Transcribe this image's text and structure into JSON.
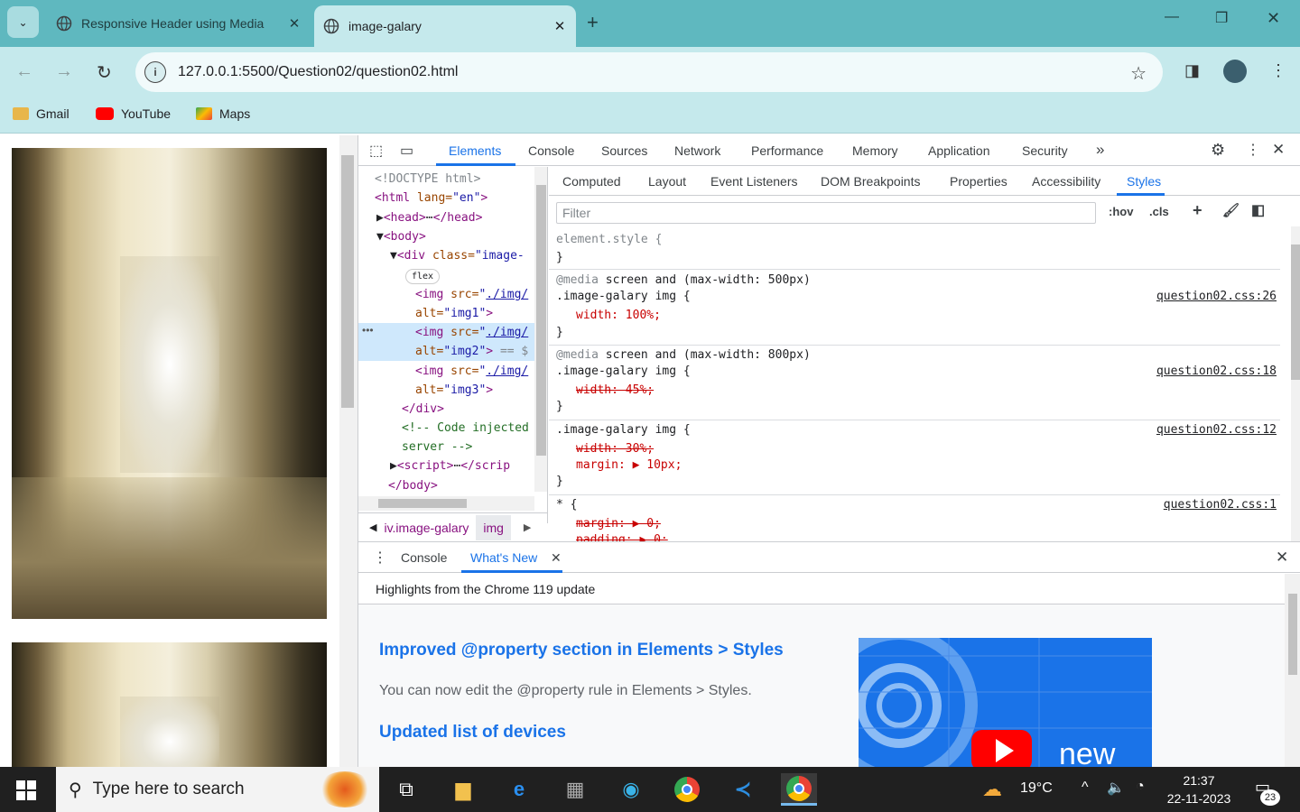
{
  "browser": {
    "tabs": [
      {
        "title": "Responsive Header using Media",
        "active": false
      },
      {
        "title": "image-galary",
        "active": true
      }
    ],
    "url": "127.0.0.1:5500/Question02/question02.html",
    "bookmarks": [
      "Gmail",
      "YouTube",
      "Maps"
    ]
  },
  "devtools": {
    "tabs": [
      "Elements",
      "Console",
      "Sources",
      "Network",
      "Performance",
      "Memory",
      "Application",
      "Security",
      "»"
    ],
    "active_tab": "Elements",
    "dom": {
      "doctype": "<!DOCTYPE html>",
      "html_tag": "<html",
      "html_attr": "lang=",
      "html_val": "\"en\"",
      "html_close": ">",
      "head": "<head>",
      "head_close": "</head>",
      "body": "<body>",
      "div_tag": "<div",
      "div_attr": "class=",
      "div_val": "\"image-",
      "flex_badge": "flex",
      "img_tag": "<img",
      "src_attr": "src=",
      "src_q": "\"",
      "src_link": "./img/",
      "alt_attr": "alt=",
      "img1_alt": "\"img1\"",
      "img2_alt": "\"img2\"",
      "img3_alt": "\"img3\"",
      "tag_close": ">",
      "sel_marker": "== $",
      "div_close": "</div>",
      "comment1": "<!-- Code injected",
      "comment2": "server -->",
      "script": "<script>",
      "script_close": "</scrip",
      "body_close": "</body>"
    },
    "breadcrumbs": [
      "iv.image-galary",
      "img"
    ],
    "styles_tabs": [
      "Computed",
      "Layout",
      "Event Listeners",
      "DOM Breakpoints",
      "Properties",
      "Accessibility",
      "Styles"
    ],
    "active_styles_tab": "Styles",
    "filter_placeholder": "Filter",
    "hov": ":hov",
    "cls": ".cls",
    "rules": {
      "element_style": "element.style {",
      "brace_close": "}",
      "media_kw": "@media",
      "media1": "screen and (max-width: 500px)",
      "selector": ".image-galary img {",
      "width100": "width: 100%;",
      "src26": "question02.css:26",
      "media2": "screen and (max-width: 800px)",
      "width45": "width: 45%;",
      "src18": "question02.css:18",
      "width30": "width: 30%;",
      "margin10": "margin: ▶ 10px;",
      "src12": "question02.css:12",
      "universal": "* {",
      "src1": "question02.css:1",
      "margin0": "margin: ▶ 0;",
      "padding0": "padding: ▶ 0;"
    },
    "drawer": {
      "tabs": [
        "Console",
        "What's New"
      ],
      "active_tab": "What's New",
      "header": "Highlights from the Chrome 119 update",
      "h1": "Improved @property section in Elements > Styles",
      "p1": "You can now edit the @property rule in Elements > Styles.",
      "h2": "Updated list of devices",
      "video_text": "new"
    }
  },
  "taskbar": {
    "search_placeholder": "Type here to search",
    "temperature": "19°C",
    "time": "21:37",
    "date": "22-11-2023",
    "notifications": "23"
  }
}
